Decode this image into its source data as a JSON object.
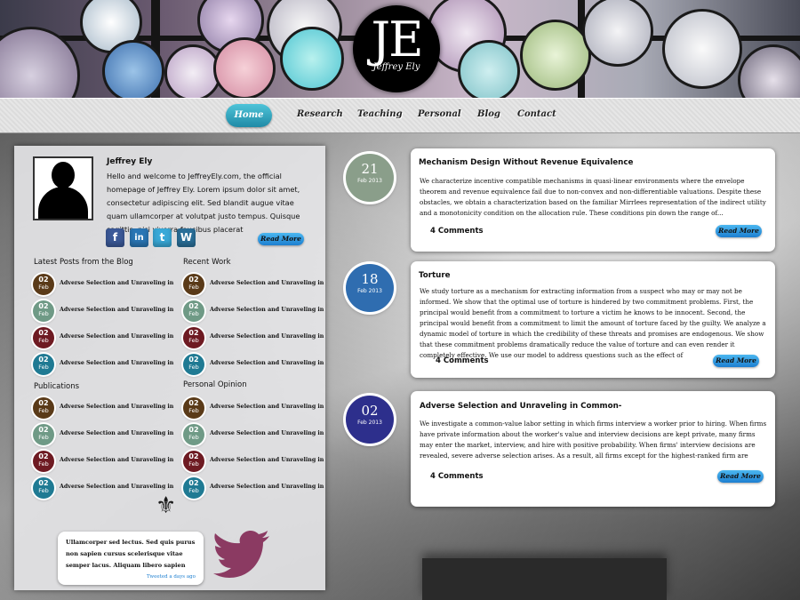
{
  "header": {
    "logo_letters": "JE",
    "logo_signature": "Jeffrey Ely"
  },
  "nav": [
    {
      "label": "Home",
      "active": true
    },
    {
      "label": "Research"
    },
    {
      "label": "Teaching"
    },
    {
      "label": "Personal"
    },
    {
      "label": "Blog"
    },
    {
      "label": "Contact"
    }
  ],
  "profile": {
    "name": "Jeffrey Ely",
    "intro": "Hello and welcome to JeffreyEly.com, the official homepage of Jeffrey Ely. Lorem ipsum dolor sit amet, consectetur adipiscing elit. Sed blandit augue vitae quam ullamcorper at volutpat justo tempus. Quisque sagittis, nisi viverra faucibus placerat",
    "social": [
      {
        "name": "facebook-icon",
        "glyph": "f",
        "color": "#3b5998"
      },
      {
        "name": "linkedin-icon",
        "glyph": "in",
        "color": "#2a76b5"
      },
      {
        "name": "twitter-icon",
        "glyph": "t",
        "color": "#39a9d8"
      },
      {
        "name": "wordpress-icon",
        "glyph": "W",
        "color": "#2a6f99"
      }
    ],
    "read_more": "Read More"
  },
  "sections": {
    "latest_posts": "Latest Posts from the Blog",
    "recent_work": "Recent Work",
    "publications": "Publications",
    "personal_opinion": "Personal Opinion",
    "item_title": "Adverse Selection and Unraveling in",
    "badge_day": "02",
    "badge_month": "Feb"
  },
  "badge_colors": [
    "#5a3a18",
    "#6f9a86",
    "#6e1a22",
    "#1f7a93"
  ],
  "tweet": {
    "text": "Ullamcorper sed lectus. Sed quis purus non sapien cursus scelerisque vitae semper lacus. Aliquam libero sapien",
    "ago": "Tweeted a days ago",
    "bird_color": "#8b3a62"
  },
  "posts": [
    {
      "day": "21",
      "month": "Feb 2013",
      "color": "#8a9e8a",
      "title": "Mechanism Design Without Revenue Equivalence",
      "excerpt": "We characterize incentive compatible mechanisms in quasi-linear environments where the envelope theorem and revenue equivalence fail due to non-convex and non-differentiable valuations. Despite these obstacles, we obtain a characterization based on the familiar Mirrlees representation of the indirect utility and a monotonicity condition on the allocation rule. These conditions pin down the range of...",
      "comments": "4 Comments",
      "read_more": "Read More"
    },
    {
      "day": "18",
      "month": "Feb 2013",
      "color": "#2f6db0",
      "title": "Torture",
      "excerpt": "We study torture as a mechanism for extracting information from a suspect who may or may not be informed. We show that the optimal use of torture is hindered by two commitment problems. First, the principal would benefit from a commitment to torture a victim he knows to be innocent. Second, the principal would benefit from a commitment to limit the amount of torture faced by the guilty. We analyze a dynamic model of torture in which the credibility of these threats and promises are endogenous. We show that these commitment problems dramatically reduce the value of torture and can even render it completely effective. We use our model to address questions such as the effect of",
      "comments": "4 Comments",
      "read_more": "Read More"
    },
    {
      "day": "02",
      "month": "Feb 2013",
      "color": "#2d2f8c",
      "title": "Adverse Selection and Unraveling in Common-",
      "excerpt": "We investigate a common-value labor setting in which firms interview a worker prior to hiring. When firms have private information about the worker's value and interview decisions are kept private, many firms may enter the market, interview, and hire with positive probability. When firms' interview decisions are revealed, severe adverse selection arises. As a result, all firms except for the highest-ranked firm are",
      "comments": "4 Comments",
      "read_more": "Read More"
    }
  ]
}
